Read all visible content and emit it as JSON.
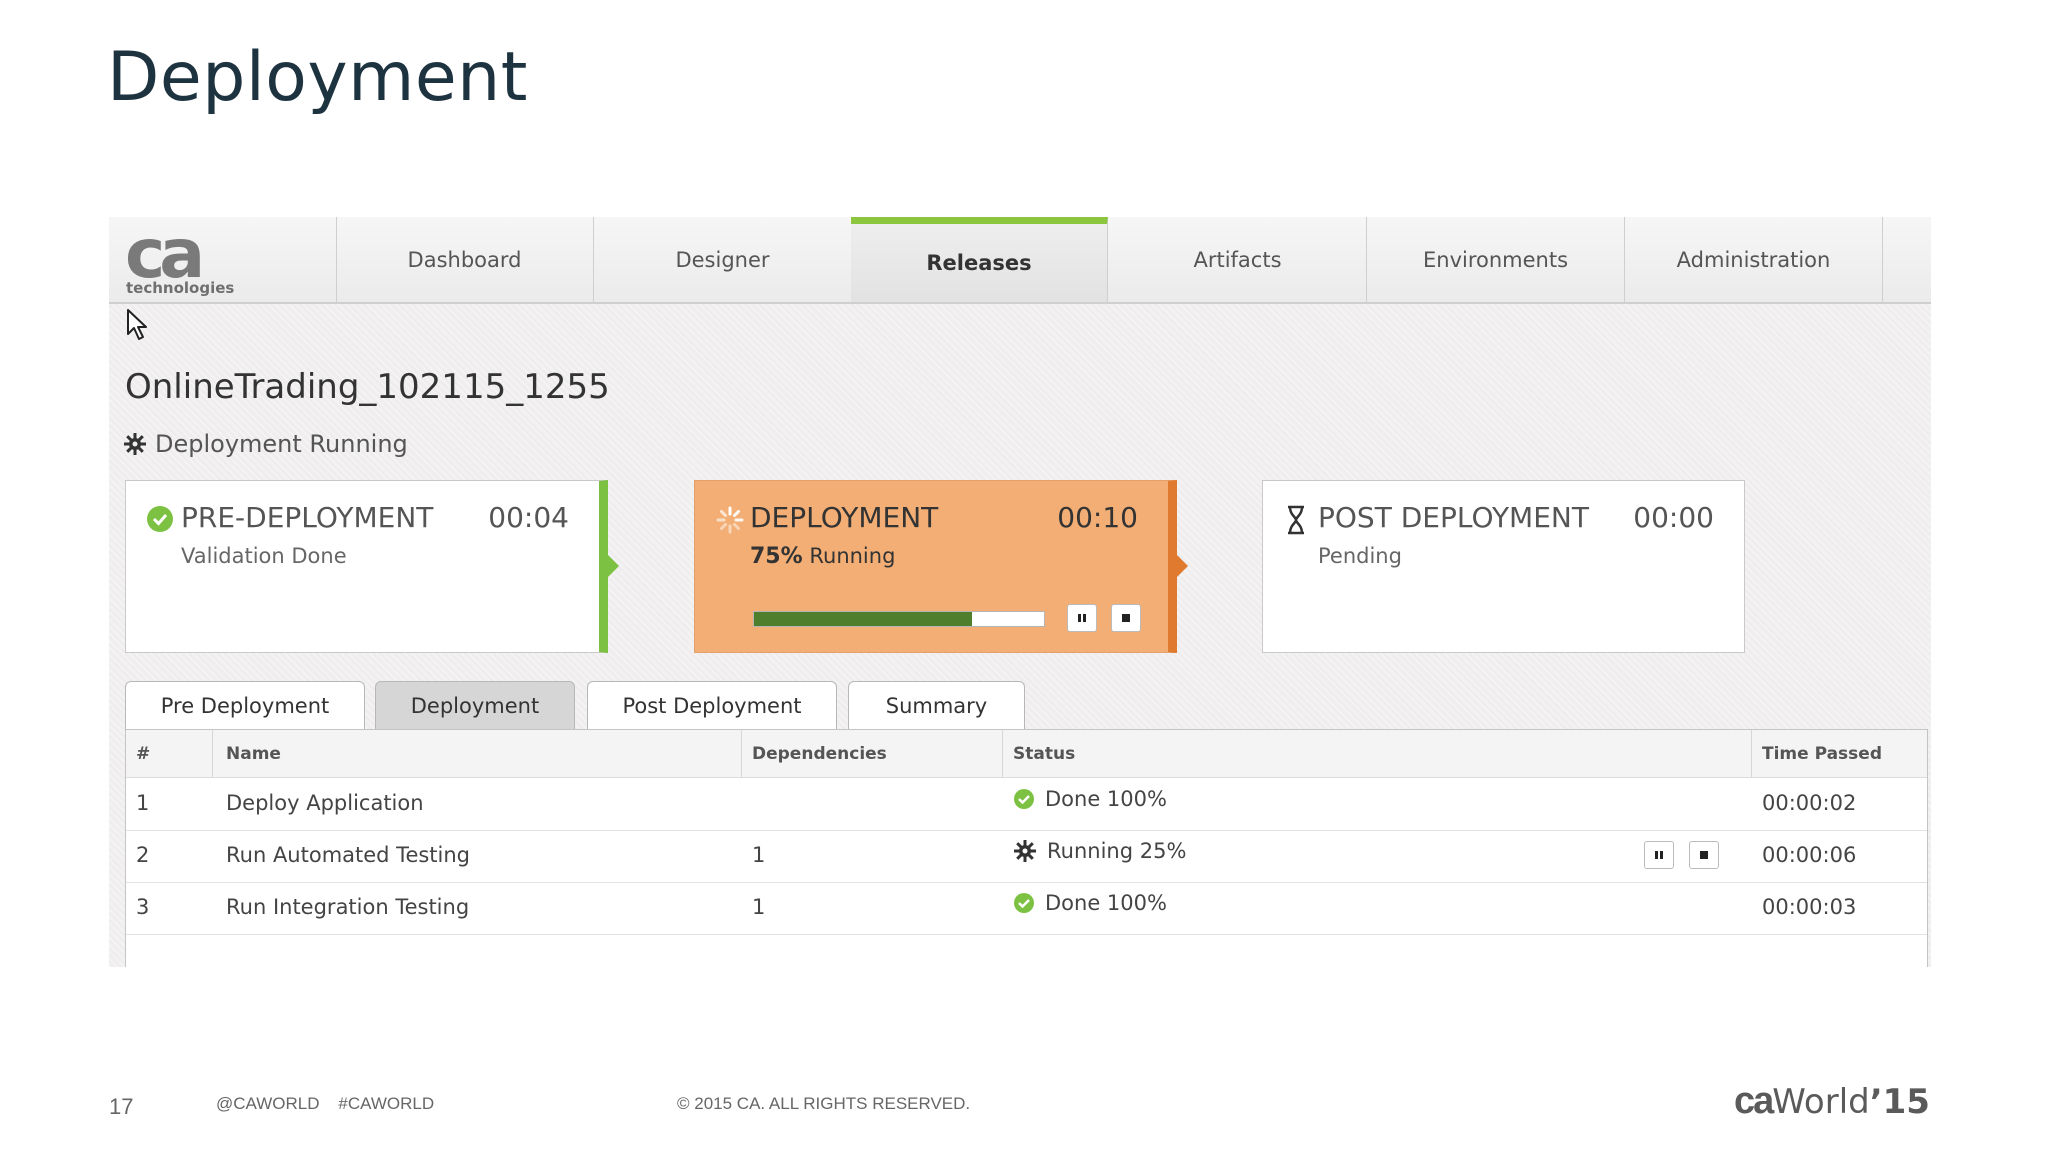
{
  "slide": {
    "title": "Deployment",
    "page_number": "17",
    "social": "@CAWORLD    #CAWORLD",
    "copyright": "© 2015 CA. ALL RIGHTS RESERVED.",
    "logo": {
      "ca": "ca",
      "world": "World",
      "year": "’15"
    }
  },
  "app": {
    "logo": {
      "mark": "ca",
      "sub": "technologies"
    },
    "nav": {
      "tabs": [
        {
          "label": "Dashboard"
        },
        {
          "label": "Designer"
        },
        {
          "label": "Releases",
          "active": true
        },
        {
          "label": "Artifacts"
        },
        {
          "label": "Environments"
        },
        {
          "label": "Administration"
        }
      ]
    },
    "release": {
      "name": "OnlineTrading_102115_1255",
      "status": "Deployment Running"
    },
    "stages": {
      "pre": {
        "name": "PRE-DEPLOYMENT",
        "time": "00:04",
        "sub": "Validation Done",
        "icon": "check-icon"
      },
      "deploy": {
        "name": "DEPLOYMENT",
        "time": "00:10",
        "percent": "75%",
        "sub": "Running",
        "progress": 0.75,
        "icon": "spinner-icon"
      },
      "post": {
        "name": "POST DEPLOYMENT",
        "time": "00:00",
        "sub": "Pending",
        "icon": "hourglass-icon"
      }
    },
    "subtabs": [
      {
        "label": "Pre Deployment"
      },
      {
        "label": "Deployment",
        "active": true
      },
      {
        "label": "Post Deployment"
      },
      {
        "label": "Summary"
      }
    ],
    "table": {
      "columns": [
        "#",
        "Name",
        "Dependencies",
        "Status",
        "Time Passed"
      ],
      "rows": [
        {
          "num": "1",
          "name": "Deploy Application",
          "deps": "",
          "status": "Done 100%",
          "status_icon": "check-icon",
          "time": "00:00:02"
        },
        {
          "num": "2",
          "name": "Run Automated Testing",
          "deps": "1",
          "status": "Running 25%",
          "status_icon": "gear-icon",
          "time": "00:00:06"
        },
        {
          "num": "3",
          "name": "Run Integration Testing",
          "deps": "1",
          "status": "Done 100%",
          "status_icon": "check-icon",
          "time": "00:00:03"
        }
      ]
    },
    "colors": {
      "accent_green": "#8cc63f",
      "running_orange": "#f2ae74",
      "progress_green": "#4f7f2c"
    }
  }
}
